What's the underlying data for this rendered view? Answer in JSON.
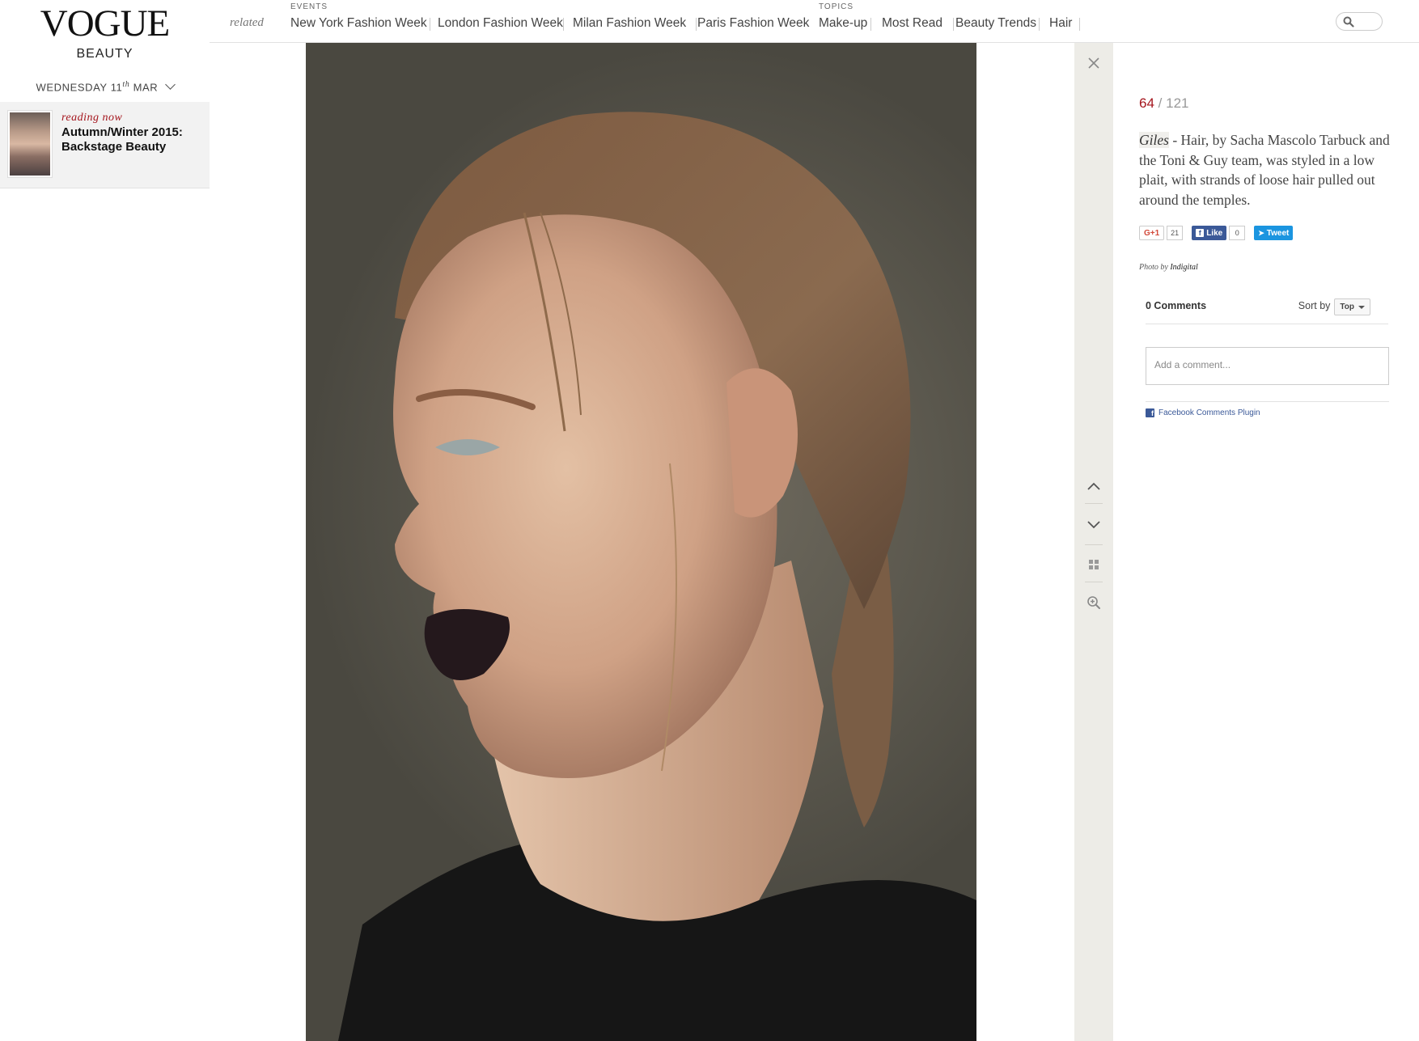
{
  "brand": {
    "logo": "VOGUE",
    "section": "BEAUTY"
  },
  "date": {
    "weekday": "WEDNESDAY",
    "day": "11",
    "suffix": "th",
    "month": "MAR"
  },
  "reading_now": {
    "label": "reading now",
    "title": "Autumn/Winter 2015: Backstage Beauty"
  },
  "nav": {
    "related_label": "related",
    "events_label": "EVENTS",
    "topics_label": "TOPICS",
    "events": [
      "New York Fashion Week",
      "London Fashion Week",
      "Milan Fashion Week",
      "Paris Fashion Week"
    ],
    "topics": [
      "Make-up",
      "Most Read",
      "Beauty Trends",
      "Hair"
    ]
  },
  "gallery": {
    "current": "64",
    "separator": "/",
    "total": "121"
  },
  "caption": {
    "designer": "Giles",
    "dash": " - ",
    "text": "Hair, by Sacha Mascolo Tarbuck and the Toni & Guy team, was styled in a low plait, with strands of loose hair pulled out around the temples."
  },
  "social": {
    "gplus_label": "G+1",
    "gplus_count": "21",
    "fb_label": "Like",
    "fb_count": "0",
    "tweet_label": "Tweet"
  },
  "credit": {
    "label": "Photo by",
    "name": "Indigital"
  },
  "comments": {
    "count_label": "0 Comments",
    "sort_label": "Sort by",
    "sort_value": "Top",
    "placeholder": "Add a comment...",
    "plugin_label": "Facebook Comments Plugin"
  },
  "colors": {
    "accent": "#a4141c",
    "rail": "#edece7",
    "facebook": "#3b5998",
    "twitter": "#1b95e0"
  },
  "icons": [
    "chevron-down-icon",
    "search-icon",
    "close-icon",
    "arrow-up-icon",
    "arrow-down-icon",
    "grid-icon",
    "zoom-in-icon",
    "facebook-icon"
  ]
}
